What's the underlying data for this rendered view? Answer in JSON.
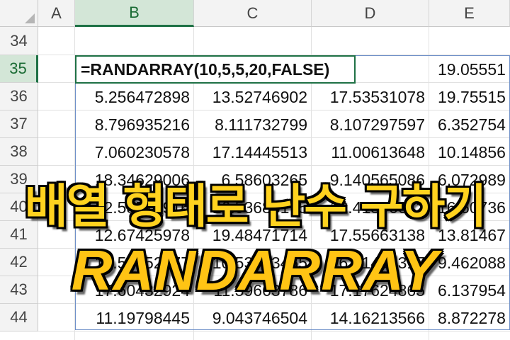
{
  "sheet": {
    "columns": [
      "A",
      "B",
      "C",
      "D",
      "E"
    ],
    "active_column": "B",
    "rows": [
      "34",
      "35",
      "36",
      "37",
      "38",
      "39",
      "40",
      "41",
      "42",
      "43",
      "44"
    ],
    "active_row": "35",
    "formula": "=RANDARRAY(10,5,5,20,FALSE)",
    "row35_e": "19.05551",
    "data": [
      [
        "5.256472898",
        "13.52746902",
        "17.53531078",
        "19.75515"
      ],
      [
        "8.796935216",
        "8.111732799",
        "8.107297597",
        "6.352754"
      ],
      [
        "7.060230578",
        "17.14445513",
        "11.00613648",
        "10.14856"
      ],
      [
        "18.34629006",
        "6.58603265",
        "9.140565086",
        "6.072989"
      ],
      [
        "12.58578916",
        "16.53685175",
        "12.41596642",
        "16.60736"
      ],
      [
        "12.67425978",
        "19.48471714",
        "17.55663138",
        "13.81467"
      ],
      [
        "14.50252677",
        "10.53703455",
        "16.41492317",
        "9.462088"
      ],
      [
        "17.60432924",
        "11.59663786",
        "17.17624865",
        "6.137954"
      ],
      [
        "11.19798445",
        "9.043746504",
        "14.16213566",
        "8.872278"
      ]
    ]
  },
  "overlay": {
    "title_korean": "배열 형태로 난수 구하기",
    "title_function": "RANDARRAY"
  }
}
